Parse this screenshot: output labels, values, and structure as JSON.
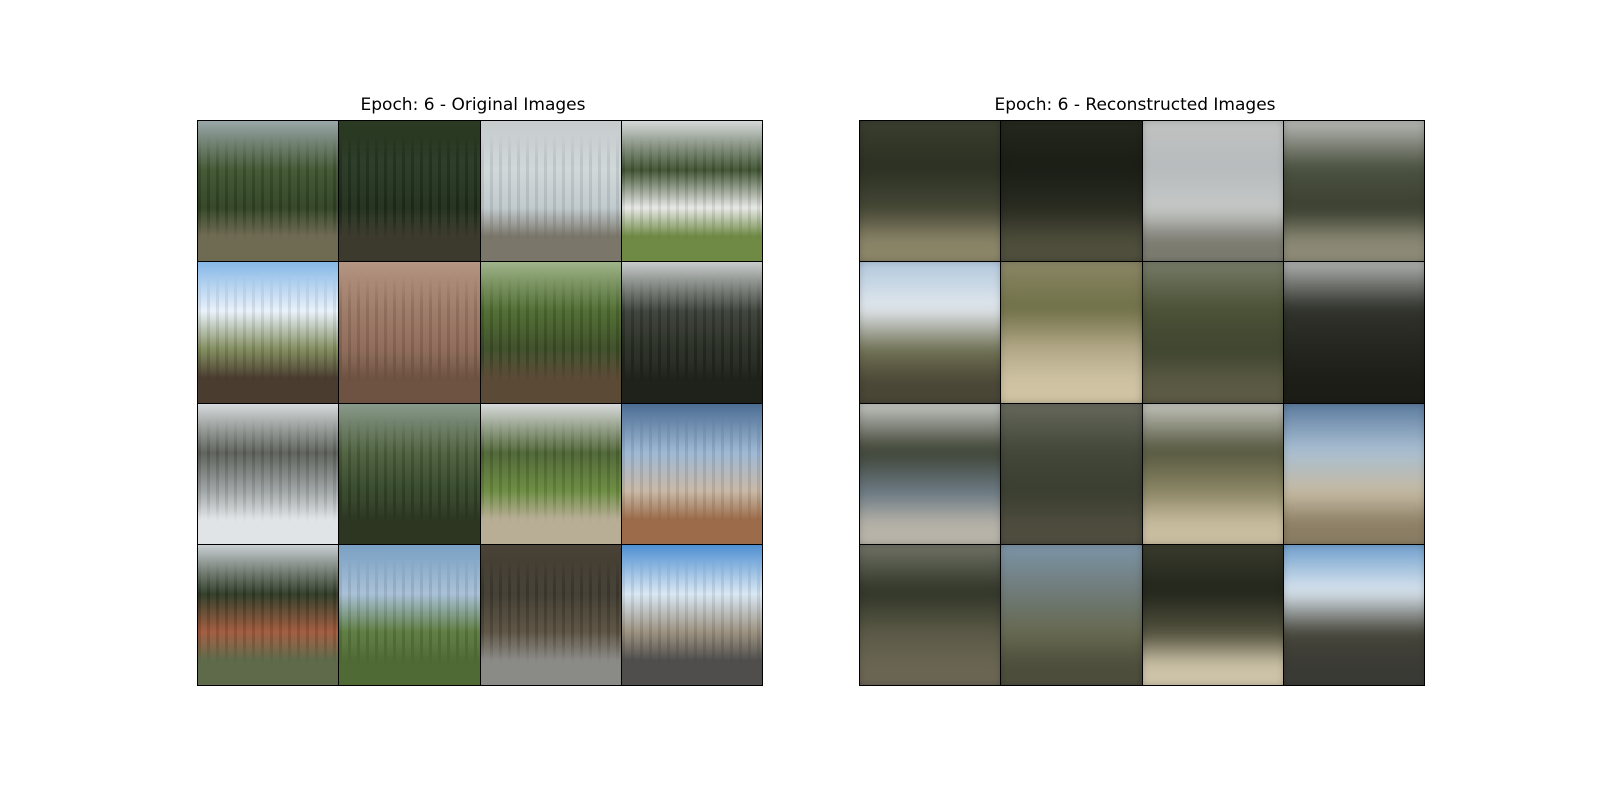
{
  "panels": [
    {
      "title": "Epoch: 6 - Original Images",
      "kind": "original",
      "tiles": [
        {
          "scene": "forest-meadow",
          "sky": "#9aa7a8",
          "top": "#3f5530",
          "mid": "#2f4222",
          "ground": "#6f6a52"
        },
        {
          "scene": "dense-forest",
          "sky": "#2b3a22",
          "top": "#263622",
          "mid": "#1f2c1a",
          "ground": "#3b3a2c"
        },
        {
          "scene": "snow-field",
          "sky": "#c7cbcd",
          "top": "#cfd7d9",
          "mid": "#bfc9cc",
          "ground": "#7a766a"
        },
        {
          "scene": "house-lawn",
          "sky": "#d5d8d9",
          "top": "#3e5230",
          "mid": "#e7e8e6",
          "ground": "#6f8a45"
        },
        {
          "scene": "sunny-field",
          "sky": "#86b7e6",
          "top": "#e9f2fb",
          "mid": "#7f8a5a",
          "ground": "#4a3c2f"
        },
        {
          "scene": "rock-cliff",
          "sky": "#b49682",
          "top": "#9c7865",
          "mid": "#8c6856",
          "ground": "#6e5242"
        },
        {
          "scene": "woodland",
          "sky": "#9fb48a",
          "top": "#4d6a2e",
          "mid": "#3b4b26",
          "ground": "#5b4a35"
        },
        {
          "scene": "dark-trees",
          "sky": "#c9cccc",
          "top": "#3a3f37",
          "mid": "#262b22",
          "ground": "#1f221b"
        },
        {
          "scene": "snow-lake",
          "sky": "#d6dadc",
          "top": "#5b5f58",
          "mid": "#9ea3a4",
          "ground": "#e0e4e6"
        },
        {
          "scene": "green-hills",
          "sky": "#8a9a8b",
          "top": "#4c5f3c",
          "mid": "#334528",
          "ground": "#2c3621"
        },
        {
          "scene": "path-park",
          "sky": "#d8dadb",
          "top": "#4d6434",
          "mid": "#6a8a3e",
          "ground": "#b8ad95"
        },
        {
          "scene": "desert-snow",
          "sky": "#4c6d93",
          "top": "#9cb7d4",
          "mid": "#c7b7a4",
          "ground": "#9c6c4a"
        },
        {
          "scene": "red-cliff",
          "sky": "#c9cfd3",
          "top": "#2d3a25",
          "mid": "#a0593c",
          "ground": "#5e6a4a"
        },
        {
          "scene": "crop-field",
          "sky": "#7aa0c3",
          "top": "#a6bfd6",
          "mid": "#5b7a3e",
          "ground": "#4f6a34"
        },
        {
          "scene": "barn-road",
          "sky": "#4a4236",
          "top": "#3e3a2f",
          "mid": "#5a5040",
          "ground": "#8a8a86"
        },
        {
          "scene": "roadside",
          "sky": "#4f8fd1",
          "top": "#d8e7f4",
          "mid": "#9a8f7d",
          "ground": "#4f4e4d"
        }
      ]
    },
    {
      "title": "Epoch: 6 - Reconstructed Images",
      "kind": "reconstructed",
      "tiles": [
        {
          "scene": "blur-forest",
          "sky": "#3b4030",
          "top": "#2b3022",
          "mid": "#464836",
          "ground": "#8b8568"
        },
        {
          "scene": "blur-dark",
          "sky": "#25291e",
          "top": "#1a1d15",
          "mid": "#2a2c22",
          "ground": "#4f4e3c"
        },
        {
          "scene": "blur-snow",
          "sky": "#c2c3c1",
          "top": "#b7bbbd",
          "mid": "#c6c8c7",
          "ground": "#7a7a6f"
        },
        {
          "scene": "blur-lawn",
          "sky": "#c8cac8",
          "top": "#4b5140",
          "mid": "#3a3f2f",
          "ground": "#8c8a76"
        },
        {
          "scene": "blur-sky",
          "sky": "#a9c2d9",
          "top": "#e2e8ee",
          "mid": "#6e6f52",
          "ground": "#4a4636"
        },
        {
          "scene": "blur-tan",
          "sky": "#8e8a6a",
          "top": "#6f7047",
          "mid": "#b5ab8a",
          "ground": "#cfc3a3"
        },
        {
          "scene": "blur-green",
          "sky": "#7c8270",
          "top": "#4b5236",
          "mid": "#3f4530",
          "ground": "#5b5a44"
        },
        {
          "scene": "blur-black",
          "sky": "#c4c6c6",
          "top": "#30322b",
          "mid": "#23251e",
          "ground": "#1c1d17"
        },
        {
          "scene": "blur-lake",
          "sky": "#dadcd9",
          "top": "#3d4233",
          "mid": "#6b7a84",
          "ground": "#b7b3a8"
        },
        {
          "scene": "blur-hills",
          "sky": "#6b6d60",
          "top": "#43473a",
          "mid": "#3a3e30",
          "ground": "#4e4c3d"
        },
        {
          "scene": "blur-path",
          "sky": "#d3d4cf",
          "top": "#55573f",
          "mid": "#8d8866",
          "ground": "#c9bda0"
        },
        {
          "scene": "blur-desert",
          "sky": "#4e6f95",
          "top": "#a9bfd3",
          "mid": "#c5b9a0",
          "ground": "#8a7d63"
        },
        {
          "scene": "blur-cliff",
          "sky": "#7b7c70",
          "top": "#2f3427",
          "mid": "#5c5a47",
          "ground": "#6a6553"
        },
        {
          "scene": "blur-field",
          "sky": "#7e98b0",
          "top": "#6f7b78",
          "mid": "#66684f",
          "ground": "#4d4d3c"
        },
        {
          "scene": "blur-barn",
          "sky": "#3b3e2e",
          "top": "#22251b",
          "mid": "#54533f",
          "ground": "#cdc3a8"
        },
        {
          "scene": "blur-road",
          "sky": "#5d93c7",
          "top": "#dbe6ef",
          "mid": "#454439",
          "ground": "#3a3a35"
        }
      ]
    }
  ]
}
